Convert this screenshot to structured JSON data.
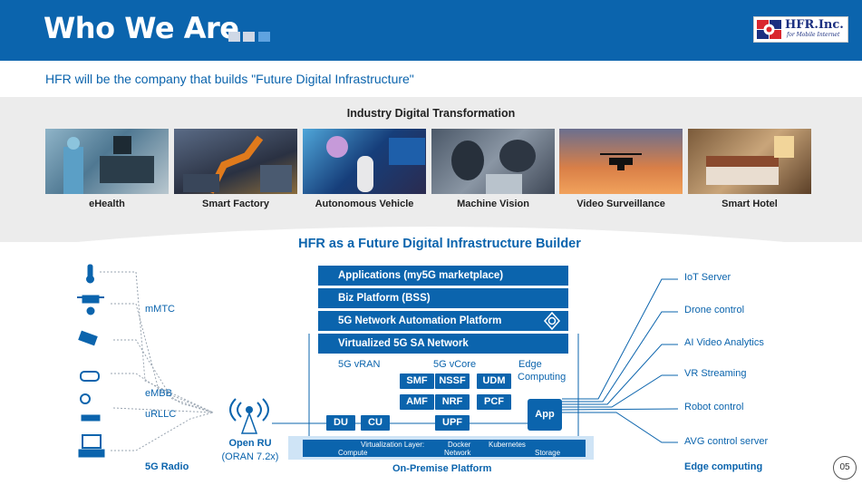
{
  "header": {
    "title": "Who We Are"
  },
  "logo": {
    "name": "HFR.Inc.",
    "tagline": "for Mobile Internet"
  },
  "subtitle": "HFR will be the company that builds \"Future Digital Infrastructure\"",
  "industry": {
    "title": "Industry Digital Transformation",
    "items": [
      {
        "label": "eHealth"
      },
      {
        "label": "Smart Factory"
      },
      {
        "label": "Autonomous Vehicle"
      },
      {
        "label": "Machine Vision"
      },
      {
        "label": "Video Surveillance"
      },
      {
        "label": "Smart Hotel"
      }
    ]
  },
  "builder": {
    "title": "HFR as a Future Digital Infrastructure Builder",
    "stack": [
      "Applications (my5G marketplace)",
      "Biz Platform (BSS)",
      "5G Network Automation Platform",
      "Virtualized 5G SA Network"
    ],
    "vran_label": "5G vRAN",
    "vcore_label": "5G vCore",
    "edge_label_1": "Edge",
    "edge_label_2": "Computing",
    "core_functions": [
      "SMF",
      "NSSF",
      "UDM",
      "AMF",
      "NRF",
      "PCF",
      "UPF"
    ],
    "ran_functions": [
      "DU",
      "CU"
    ],
    "app_label": "App",
    "virtualization": {
      "layer": "Virtualization Layer:",
      "docker": "Docker",
      "kubernetes": "Kubernetes",
      "compute": "Compute",
      "network": "Network",
      "storage": "Storage"
    },
    "platform_label": "On-Premise Platform",
    "open_ru": "Open RU",
    "oran": "(ORAN 7.2x)",
    "left_labels": {
      "mmtc": "mMTC",
      "embb": "eMBB",
      "urllc": "uRLLC",
      "radio": "5G Radio"
    },
    "right_labels": [
      "IoT Server",
      "Drone control",
      "AI Video Analytics",
      "VR Streaming",
      "Robot control",
      "AVG control server"
    ],
    "edge_footer": "Edge computing"
  },
  "page_number": "05",
  "colors": {
    "primary": "#0b64ad",
    "band": "#ececec"
  }
}
